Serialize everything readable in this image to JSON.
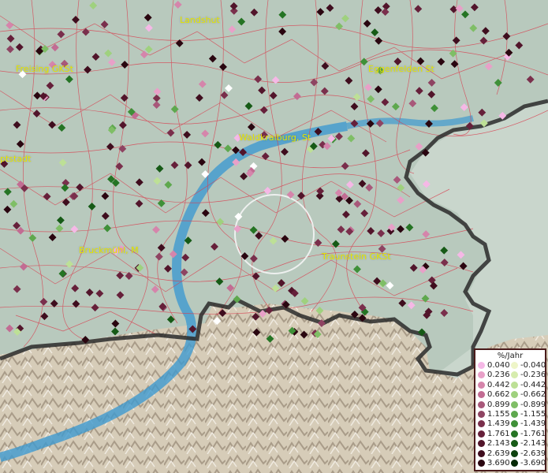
{
  "map": {
    "cities": [
      {
        "id": "landshut",
        "name": "Landshut"
      },
      {
        "id": "freising",
        "name": "Freising GKSt"
      },
      {
        "id": "eggenfelden",
        "name": "Eggenfelden St"
      },
      {
        "id": "waldkraiburg",
        "name": "Waldkraiburg, St"
      },
      {
        "id": "pfaffenhofen",
        "name": "ptstadt"
      },
      {
        "id": "bruckmuehl",
        "name": "Bruckmühl, M"
      },
      {
        "id": "traunstein",
        "name": "Traunstein GKSt"
      }
    ]
  },
  "legend": {
    "title": "%/Jahr",
    "positive": [
      {
        "label": "0.040",
        "color": "#f5b8e6"
      },
      {
        "label": "0.236",
        "color": "#e8a0c8"
      },
      {
        "label": "0.442",
        "color": "#d585ab"
      },
      {
        "label": "0.662",
        "color": "#c26c93"
      },
      {
        "label": "0.899",
        "color": "#a8587a"
      },
      {
        "label": "1.155",
        "color": "#8e4462"
      },
      {
        "label": "1.439",
        "color": "#7a2f4c"
      },
      {
        "label": "1.761",
        "color": "#66203a"
      },
      {
        "label": "2.143",
        "color": "#52152b"
      },
      {
        "label": "2.639",
        "color": "#3f0d1e"
      },
      {
        "label": "3.690",
        "color": "#2a0610"
      }
    ],
    "negative": [
      {
        "label": "-0.040",
        "color": "#eef5c8"
      },
      {
        "label": "-0.236",
        "color": "#d6ecae"
      },
      {
        "label": "-0.442",
        "color": "#bde096"
      },
      {
        "label": "-0.662",
        "color": "#9fd17e"
      },
      {
        "label": "-0.899",
        "color": "#7fbe66"
      },
      {
        "label": "-1.155",
        "color": "#5ea84e"
      },
      {
        "label": "-1.439",
        "color": "#3f9038"
      },
      {
        "label": "-1.761",
        "color": "#257424"
      },
      {
        "label": "-2.143",
        "color": "#165a16"
      },
      {
        "label": "-2.639",
        "color": "#0e420f"
      },
      {
        "label": "-3.690",
        "color": "#062906"
      }
    ]
  }
}
